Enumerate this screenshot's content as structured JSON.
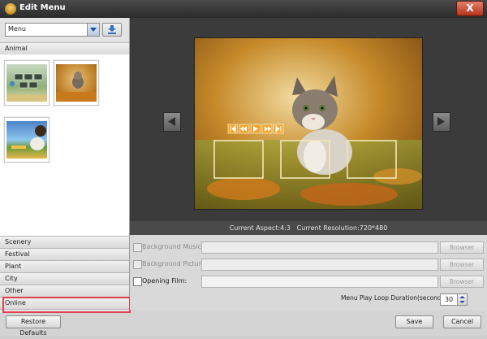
{
  "window": {
    "title": "Edit Menu",
    "close_label": "X"
  },
  "left_panel": {
    "dropdown_value": "Menu",
    "groups": [
      {
        "label": "Animal"
      },
      {
        "label": "Scenery"
      },
      {
        "label": "Festival"
      },
      {
        "label": "Plant"
      },
      {
        "label": "City"
      },
      {
        "label": "Other"
      },
      {
        "label": "Online"
      }
    ],
    "restore_label": "Restore Defaults"
  },
  "preview": {
    "aspect_label": "Current Aspect:4:3",
    "resolution_label": "Current Resolution:720*480"
  },
  "settings": {
    "background_music_label": "Background Music:",
    "background_picture_label": "Background Picture:",
    "opening_film_label": "Opening Film:",
    "browse_label": "Browser",
    "duration_label": "Menu Play Loop Duration(seconds):",
    "duration_value": "30"
  },
  "footer": {
    "save_label": "Save",
    "cancel_label": "Cancel"
  },
  "colors": {
    "accent_highlight": "#e0404e",
    "preview_bg": "#3b3b3b"
  }
}
